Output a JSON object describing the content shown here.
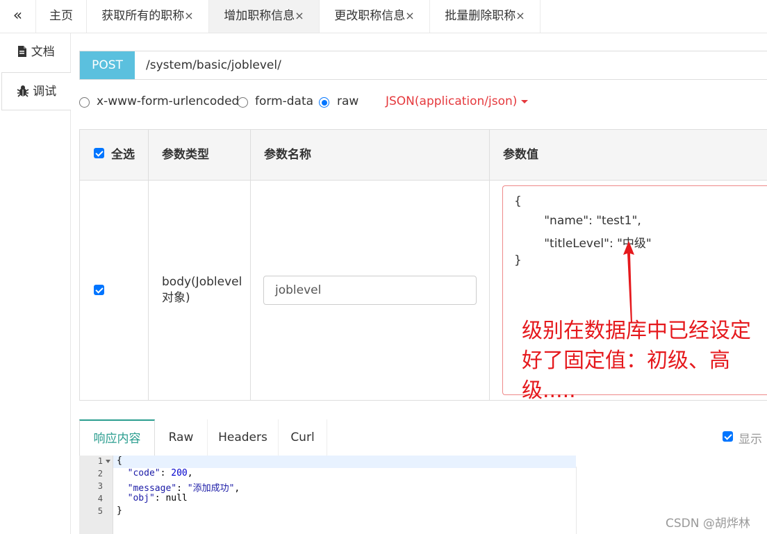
{
  "top_tabs": {
    "collapse_icon": "«",
    "home": "主页",
    "tabs": [
      {
        "label": "获取所有的职称",
        "close": "×"
      },
      {
        "label": "增加职称信息",
        "close": "×"
      },
      {
        "label": "更改职称信息",
        "close": "×"
      },
      {
        "label": "批量删除职称",
        "close": "×"
      }
    ]
  },
  "sidebar": {
    "items": [
      {
        "icon": "document-icon",
        "label": "文档"
      },
      {
        "icon": "bug-icon",
        "label": "调试"
      }
    ]
  },
  "request": {
    "method": "POST",
    "url": "/system/basic/joblevel/",
    "body_types": [
      "x-www-form-urlencoded",
      "form-data",
      "raw"
    ],
    "selected_body_type": "raw",
    "content_type": "JSON(application/json)"
  },
  "params": {
    "headers": {
      "select_all": "全选",
      "type": "参数类型",
      "name": "参数名称",
      "value": "参数值"
    },
    "row": {
      "checked": true,
      "type": "body(Joblevel对象)",
      "name_value": "joblevel",
      "json_lines": [
        "{",
        "        \"name\": \"test1\",",
        "        \"titleLevel\": \"中级\"",
        "}"
      ]
    },
    "annotation": "级别在数据库中已经设定好了固定值：初级、高级....."
  },
  "response": {
    "tabs": [
      "响应内容",
      "Raw",
      "Headers",
      "Curl"
    ],
    "active_tab": "响应内容",
    "show_label": "显示",
    "line_numbers": [
      "1",
      "2",
      "3",
      "4",
      "5"
    ],
    "lines": {
      "l1": "{",
      "l2_key": "\"code\"",
      "l2_val": "200",
      "l3_key": "\"message\"",
      "l3_val": "\"添加成功\"",
      "l4_key": "\"obj\"",
      "l4_val": "null",
      "l5": "}"
    }
  },
  "watermark": "CSDN @胡烨林",
  "colors": {
    "method_bg": "#5bc0de",
    "accent": "#2a9d8f",
    "annotation": "#e5191d",
    "content_type": "#e5393d"
  }
}
